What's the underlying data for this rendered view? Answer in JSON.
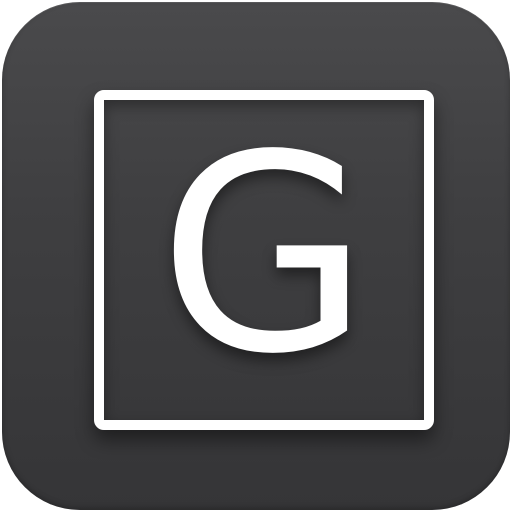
{
  "icon": {
    "name": "g-letter-app-icon",
    "letter": "G",
    "colors": {
      "tile_top": "#4a4a4c",
      "tile_bottom": "#353537",
      "foreground": "#ffffff"
    }
  }
}
